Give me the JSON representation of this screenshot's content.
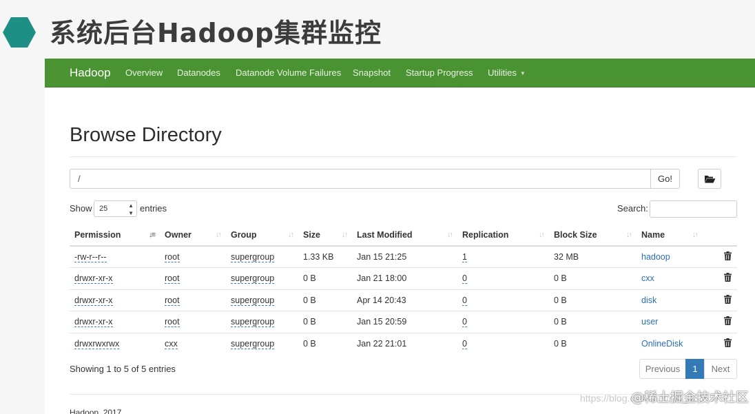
{
  "slide": {
    "title": "系统后台Hadoop集群监控"
  },
  "navbar": {
    "brand": "Hadoop",
    "items": [
      {
        "label": "Overview"
      },
      {
        "label": "Datanodes"
      },
      {
        "label": "Datanode Volume Failures"
      },
      {
        "label": "Snapshot"
      },
      {
        "label": "Startup Progress"
      },
      {
        "label": "Utilities"
      }
    ]
  },
  "page": {
    "heading": "Browse Directory",
    "path_value": "/",
    "go_label": "Go!",
    "show_label": "Show",
    "page_length": "25",
    "entries_label": "entries",
    "search_label": "Search:",
    "search_value": ""
  },
  "table": {
    "headers": [
      "Permission",
      "Owner",
      "Group",
      "Size",
      "Last Modified",
      "Replication",
      "Block Size",
      "Name"
    ],
    "rows": [
      {
        "permission": "-rw-r--r--",
        "owner": "root",
        "group": "supergroup",
        "size": "1.33 KB",
        "modified": "Jan 15 21:25",
        "replication": "1",
        "block_size": "32 MB",
        "name": "hadoop"
      },
      {
        "permission": "drwxr-xr-x",
        "owner": "root",
        "group": "supergroup",
        "size": "0 B",
        "modified": "Jan 21 18:00",
        "replication": "0",
        "block_size": "0 B",
        "name": "cxx"
      },
      {
        "permission": "drwxr-xr-x",
        "owner": "root",
        "group": "supergroup",
        "size": "0 B",
        "modified": "Apr 14 20:43",
        "replication": "0",
        "block_size": "0 B",
        "name": "disk"
      },
      {
        "permission": "drwxr-xr-x",
        "owner": "root",
        "group": "supergroup",
        "size": "0 B",
        "modified": "Jan 15 20:59",
        "replication": "0",
        "block_size": "0 B",
        "name": "user"
      },
      {
        "permission": "drwxrwxrwx",
        "owner": "cxx",
        "group": "supergroup",
        "size": "0 B",
        "modified": "Jan 22 21:01",
        "replication": "0",
        "block_size": "0 B",
        "name": "OnlineDisk"
      }
    ]
  },
  "footer": {
    "showing": "Showing 1 to 5 of 5 entries",
    "previous": "Previous",
    "current_page": "1",
    "next": "Next",
    "copyright": "Hadoop, 2017."
  },
  "watermark": {
    "faint": "https://blog.csdn.net/m0_4655575",
    "text": "@稀土掘金技术社区"
  },
  "colors": {
    "navbar": "#4a9332",
    "link": "#2a6ebb",
    "accent_hexagon": "#1e8f84",
    "pager_active": "#337ab7"
  }
}
